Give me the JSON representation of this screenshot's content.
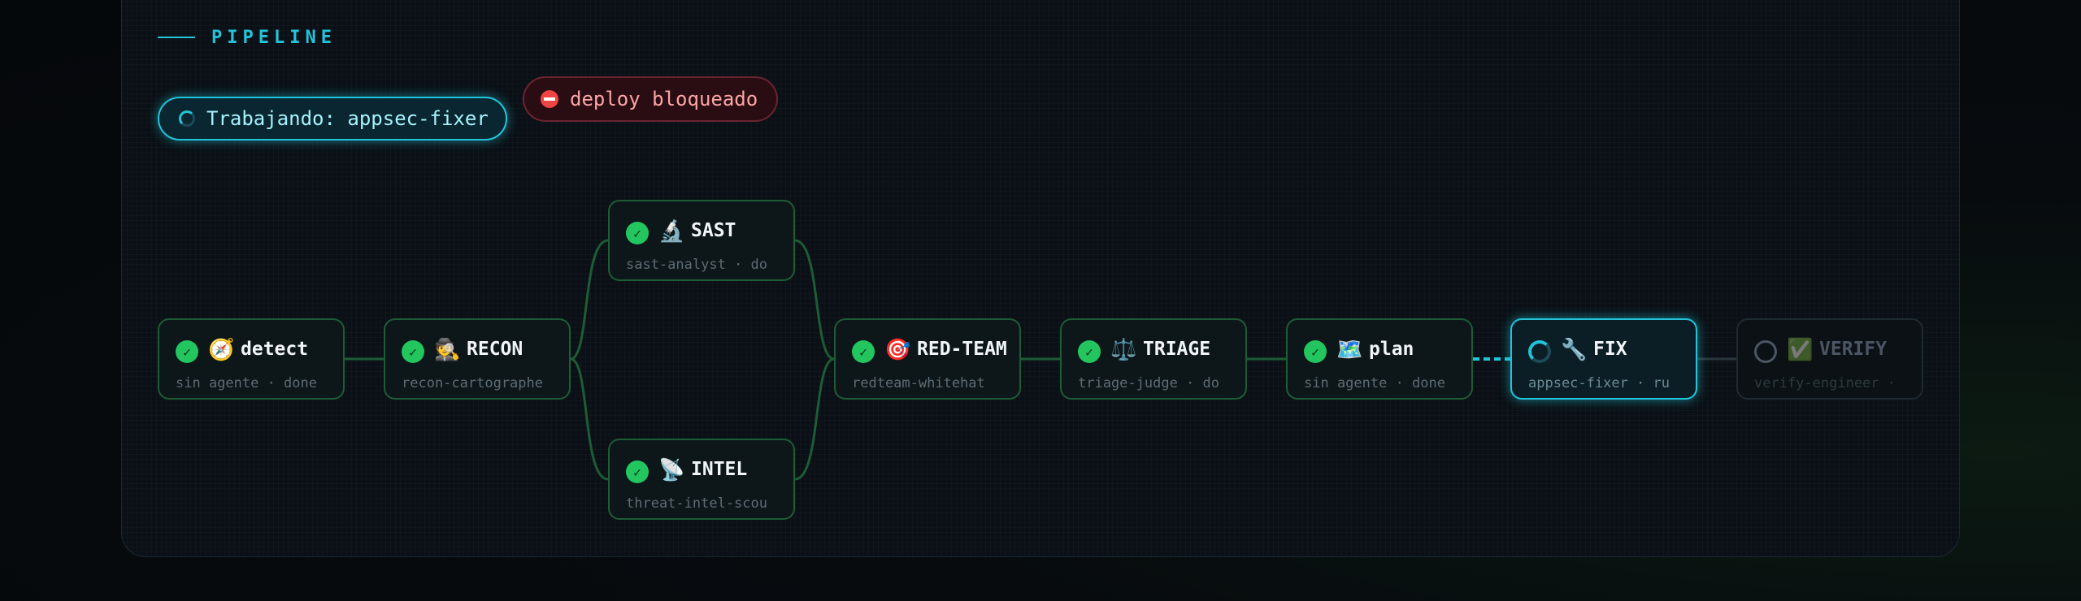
{
  "pipeline": {
    "title": "PIPELINE"
  },
  "status": {
    "working_label": "Trabajando: appsec-fixer",
    "blocked_label": "deploy bloqueado"
  },
  "colors": {
    "accent": "#22c4da",
    "done": "#22c55e",
    "blocked": "#ef4444",
    "pending": "#4b5563"
  },
  "nodes": [
    {
      "id": "detect",
      "name": "detect",
      "icon": "compass-icon",
      "emoji": "🧭",
      "sub": "sin agente · done",
      "state": "done"
    },
    {
      "id": "recon",
      "name": "RECON",
      "icon": "spy-icon",
      "emoji": "🕵️",
      "sub": "recon-cartographe",
      "state": "done"
    },
    {
      "id": "sast",
      "name": "SAST",
      "icon": "microscope-icon",
      "emoji": "🔬",
      "sub": "sast-analyst · do",
      "state": "done"
    },
    {
      "id": "intel",
      "name": "INTEL",
      "icon": "satellite-icon",
      "emoji": "📡",
      "sub": "threat-intel-scou",
      "state": "done"
    },
    {
      "id": "redteam",
      "name": "RED-TEAM",
      "icon": "target-icon",
      "emoji": "🎯",
      "sub": "redteam-whitehat",
      "state": "done"
    },
    {
      "id": "triage",
      "name": "TRIAGE",
      "icon": "scales-icon",
      "emoji": "⚖️",
      "sub": "triage-judge · do",
      "state": "done"
    },
    {
      "id": "plan",
      "name": "plan",
      "icon": "map-icon",
      "emoji": "🗺️",
      "sub": "sin agente · done",
      "state": "done"
    },
    {
      "id": "fix",
      "name": "FIX",
      "icon": "wrench-icon",
      "emoji": "🔧",
      "sub": "appsec-fixer · ru",
      "state": "running"
    },
    {
      "id": "verify",
      "name": "VERIFY",
      "icon": "check-box-icon",
      "emoji": "✅",
      "sub": "verify-engineer ·",
      "state": "pending"
    }
  ]
}
